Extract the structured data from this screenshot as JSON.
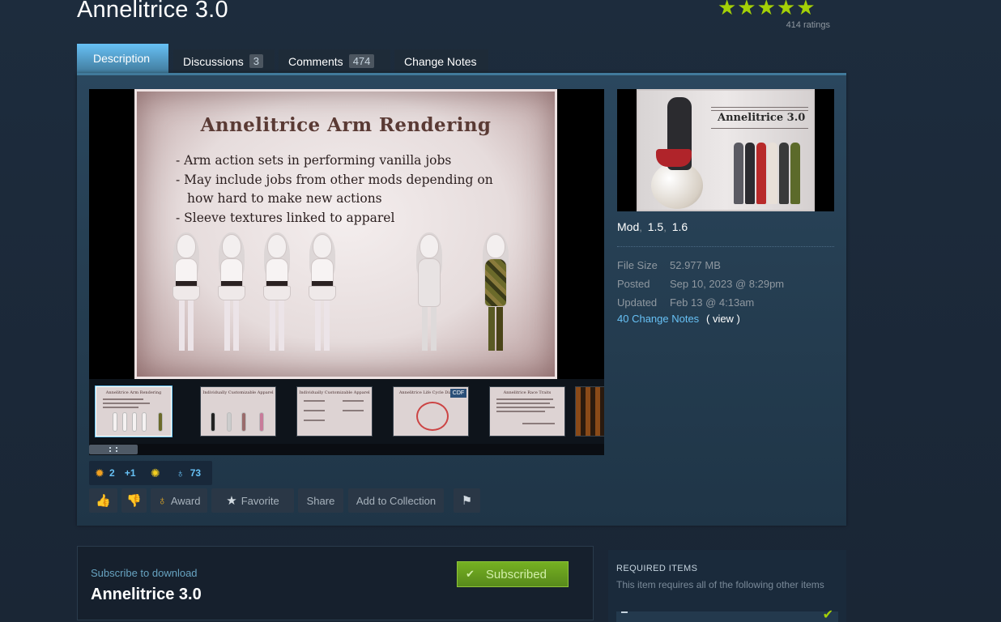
{
  "item": {
    "title": "Annelitrice 3.0",
    "stars": "★★★★★",
    "ratings": "414 ratings"
  },
  "tabs": [
    {
      "label": "Description",
      "count": ""
    },
    {
      "label": "Discussions",
      "count": "3"
    },
    {
      "label": "Comments",
      "count": "474"
    },
    {
      "label": "Change Notes",
      "count": ""
    }
  ],
  "media": {
    "slide_title": "Annelitrice Arm Rendering",
    "bullets": [
      "- Arm action sets in performing vanilla jobs",
      "- May include jobs from other mods depending on",
      "how hard to make new actions",
      "- Sleeve textures linked to apparel"
    ],
    "thumbnails": [
      {
        "title": "Annelitrice Arm Rendering"
      },
      {
        "title": "Individually Customizable Apparel"
      },
      {
        "title": "Individually Customizable Apparel"
      },
      {
        "title": "Annelitrice Life Cycle Diagram",
        "badge": "CDF"
      },
      {
        "title": "Annelitrice Race Traits"
      },
      {
        "title": ""
      }
    ]
  },
  "preview": {
    "title": "Annelitrice 3.0"
  },
  "details": {
    "tags": [
      "Mod",
      "1.5",
      "1.6"
    ],
    "tag_separator": ",",
    "file_size_label": "File Size",
    "file_size": "52.977 MB",
    "posted_label": "Posted",
    "posted": "Sep 10, 2023 @ 8:29pm",
    "updated_label": "Updated",
    "updated": "Feb 13 @ 4:13am",
    "change_notes_link": "40 Change Notes",
    "change_notes_view": "( view )"
  },
  "awards": [
    {
      "icon": "award-medal-icon",
      "count": "2"
    },
    {
      "icon": "plus-one-icon",
      "count": ""
    },
    {
      "icon": "lightbulb-icon",
      "count": ""
    },
    {
      "icon": "ribbon-icon",
      "count": "73"
    }
  ],
  "actions": {
    "award": "Award",
    "favorite": "Favorite",
    "share": "Share",
    "add_to_collection": "Add to Collection"
  },
  "subscribe": {
    "label": "Subscribe to download",
    "title": "Annelitrice 3.0",
    "button": "Subscribed"
  },
  "required": {
    "title": "REQUIRED ITEMS",
    "desc": "This item requires all of the following other items"
  },
  "colors": {
    "accent": "#67c1f5",
    "stars": "#a4d007",
    "subscribed_green": "#75b022",
    "background": "#1b2838"
  }
}
